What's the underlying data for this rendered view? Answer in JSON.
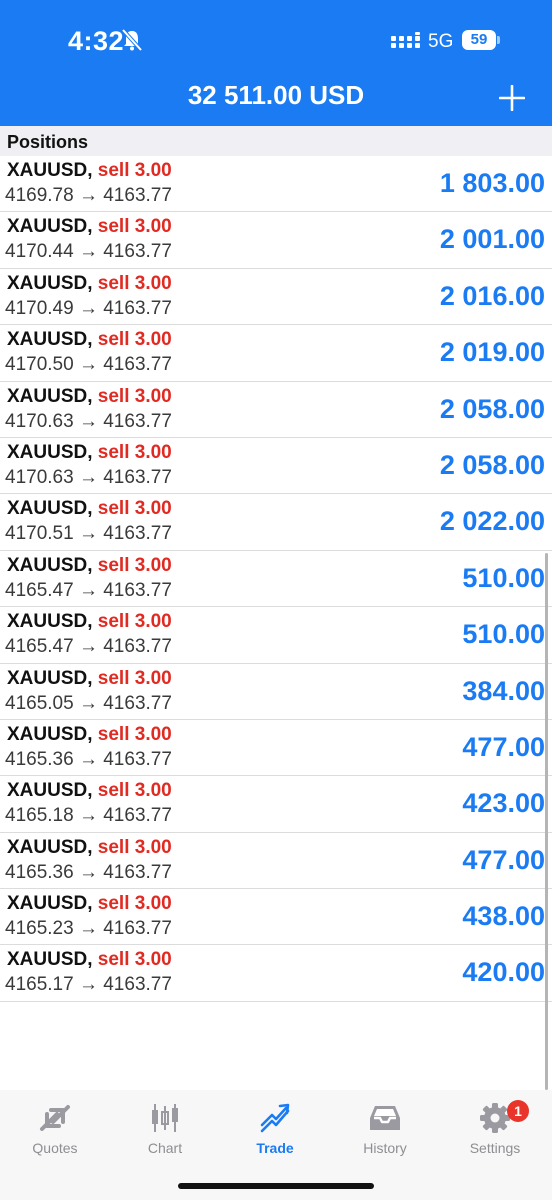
{
  "status_bar": {
    "time": "4:32",
    "network": "5G",
    "battery": "59"
  },
  "header": {
    "balance": "32 511.00 USD"
  },
  "positions": {
    "title": "Positions",
    "rows": [
      {
        "symbol": "XAUUSD,",
        "side": "sell 3.00",
        "prices": "4169.78 → 4163.77",
        "profit": "1 803.00"
      },
      {
        "symbol": "XAUUSD,",
        "side": "sell 3.00",
        "prices": "4170.44 → 4163.77",
        "profit": "2 001.00"
      },
      {
        "symbol": "XAUUSD,",
        "side": "sell 3.00",
        "prices": "4170.49 → 4163.77",
        "profit": "2 016.00"
      },
      {
        "symbol": "XAUUSD,",
        "side": "sell 3.00",
        "prices": "4170.50 → 4163.77",
        "profit": "2 019.00"
      },
      {
        "symbol": "XAUUSD,",
        "side": "sell 3.00",
        "prices": "4170.63 → 4163.77",
        "profit": "2 058.00"
      },
      {
        "symbol": "XAUUSD,",
        "side": "sell 3.00",
        "prices": "4170.63 → 4163.77",
        "profit": "2 058.00"
      },
      {
        "symbol": "XAUUSD,",
        "side": "sell 3.00",
        "prices": "4170.51 → 4163.77",
        "profit": "2 022.00"
      },
      {
        "symbol": "XAUUSD,",
        "side": "sell 3.00",
        "prices": "4165.47 → 4163.77",
        "profit": "510.00"
      },
      {
        "symbol": "XAUUSD,",
        "side": "sell 3.00",
        "prices": "4165.47 → 4163.77",
        "profit": "510.00"
      },
      {
        "symbol": "XAUUSD,",
        "side": "sell 3.00",
        "prices": "4165.05 → 4163.77",
        "profit": "384.00"
      },
      {
        "symbol": "XAUUSD,",
        "side": "sell 3.00",
        "prices": "4165.36 → 4163.77",
        "profit": "477.00"
      },
      {
        "symbol": "XAUUSD,",
        "side": "sell 3.00",
        "prices": "4165.18 → 4163.77",
        "profit": "423.00"
      },
      {
        "symbol": "XAUUSD,",
        "side": "sell 3.00",
        "prices": "4165.36 → 4163.77",
        "profit": "477.00"
      },
      {
        "symbol": "XAUUSD,",
        "side": "sell 3.00",
        "prices": "4165.23 → 4163.77",
        "profit": "438.00"
      },
      {
        "symbol": "XAUUSD,",
        "side": "sell 3.00",
        "prices": "4165.17 → 4163.77",
        "profit": "420.00"
      }
    ]
  },
  "tabbar": {
    "tabs": [
      {
        "label": "Quotes",
        "icon": "quotes-icon",
        "active": false
      },
      {
        "label": "Chart",
        "icon": "candlestick-icon",
        "active": false
      },
      {
        "label": "Trade",
        "icon": "trade-trend-icon",
        "active": true
      },
      {
        "label": "History",
        "icon": "inbox-tray-icon",
        "active": false
      },
      {
        "label": "Settings",
        "icon": "gear-icon",
        "active": false,
        "badge": "1"
      }
    ]
  },
  "colors": {
    "accent": "#1a7bf3",
    "sell": "#e02a22",
    "badge": "#e8342b"
  }
}
